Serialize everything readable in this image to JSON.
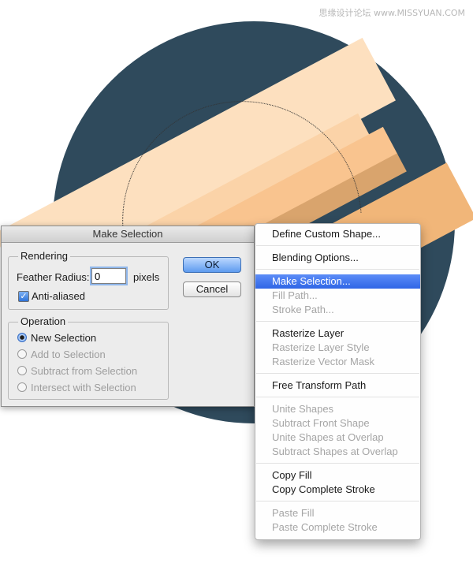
{
  "watermark": "思缘设计论坛 www.MISSYUAN.COM",
  "colors": {
    "circle": "#2f4a5c",
    "stripe_light": "#fde0bf",
    "stripe_mid": "#f9c48f",
    "stripe_dark": "#d9a46d",
    "menu_highlight": "#2f66e6"
  },
  "dialog": {
    "title": "Make Selection",
    "rendering": {
      "label": "Rendering",
      "feather_label": "Feather Radius:",
      "feather_value": "0",
      "feather_unit": "pixels",
      "anti_aliased_label": "Anti-aliased",
      "anti_aliased_checked": true
    },
    "buttons": {
      "ok": "OK",
      "cancel": "Cancel"
    },
    "operation": {
      "label": "Operation",
      "options": [
        "New Selection",
        "Add to Selection",
        "Subtract from Selection",
        "Intersect with Selection"
      ],
      "selected": "New Selection"
    }
  },
  "menu": {
    "items": [
      "Define Custom Shape...",
      "Blending Options...",
      "Make Selection...",
      "Fill Path...",
      "Stroke Path...",
      "Rasterize Layer",
      "Rasterize Layer Style",
      "Rasterize Vector Mask",
      "Free Transform Path",
      "Unite Shapes",
      "Subtract Front Shape",
      "Unite Shapes at Overlap",
      "Subtract Shapes at Overlap",
      "Copy Fill",
      "Copy Complete Stroke",
      "Paste Fill",
      "Paste Complete Stroke"
    ],
    "highlighted": "Make Selection..."
  }
}
